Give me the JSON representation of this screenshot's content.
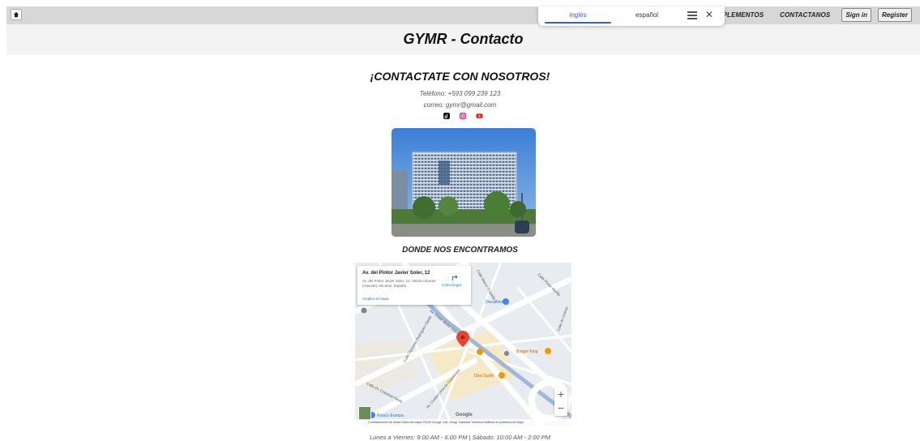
{
  "nav": {
    "home_icon": "home-icon",
    "links": [
      "SUPLEMENTOS",
      "CONTACTANOS"
    ],
    "sign_in": "Sign in",
    "register": "Register"
  },
  "translate_bar": {
    "active_tab": "inglés",
    "other_tab": "español",
    "menu_icon": "hamburger-icon",
    "close_icon": "close-icon",
    "accent": "#3a5bd9"
  },
  "header": {
    "title": "GYMR - Contacto"
  },
  "contact": {
    "heading": "¡CONTACTATE CON NOSOTROS!",
    "phone": "Teléfono: +593 099 239 123",
    "email": "correo: gymr@gmail.com",
    "social_icons": [
      "tiktok-icon",
      "instagram-icon",
      "youtube-icon"
    ]
  },
  "location": {
    "heading": "DONDE NOS ENCONTRAMOS",
    "map": {
      "place_name": "Av. del Pintor Javier Soler, 12",
      "address": "Av. del Pintor Javier Soler, 12, 03015 Alicante (Alacant), Alicante, España",
      "directions": "Cómo llegar",
      "enlarge": "Ampliar el mapa",
      "labels": [
        "Decathlon",
        "Burger King",
        "Dosi Sushi",
        "Rosa's Europa",
        "Calle Dr. Cristóbal Pardo",
        "Calle Diputado Rodríguez Ojeda",
        "Av. Pintor Javier Soler",
        "Av. Ciudad Lliria de Guadalupe",
        "Calle Marco Trapiello",
        "Calle Pintor Murillo",
        "Calle de Oviedo"
      ],
      "footer": "Combinaciones de teclas   Datos del mapa ©2025 Google, Inst. Geogr. Nacional   Términos   Notificar un problema de Maps",
      "brand": "Google",
      "zoom_in": "+",
      "zoom_out": "−"
    }
  },
  "hours": "Lunes a Viernes: 9:00 AM - 6:00 PM | Sábado: 10:00 AM - 2:00 PM"
}
